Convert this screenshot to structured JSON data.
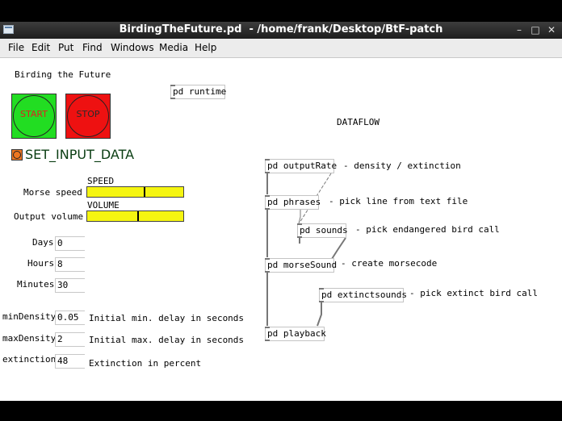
{
  "window": {
    "title": "BirdingTheFuture.pd  - /home/frank/Desktop/BtF-patch",
    "minimize_glyph": "–",
    "maximize_glyph": "□",
    "close_glyph": "✕"
  },
  "menu": [
    "File",
    "Edit",
    "Put",
    "Find",
    "Windows",
    "Media",
    "Help"
  ],
  "patch": {
    "heading": "Birding the Future",
    "start_label": "START",
    "stop_label": "STOP",
    "set_input_label": "SET_INPUT_DATA",
    "runtime_object": "pd runtime",
    "dataflow_label": "DATAFLOW",
    "speed_header": "SPEED",
    "volume_header": "VOLUME",
    "morse_speed_label": "Morse speed",
    "output_volume_label": "Output volume",
    "speed_level": 0.6,
    "volume_level": 0.53,
    "params": [
      {
        "label": "Days",
        "value": "0"
      },
      {
        "label": "Hours",
        "value": "8"
      },
      {
        "label": "Minutes",
        "value": "30"
      },
      {
        "label": "minDensity",
        "value": "0.05",
        "desc": "Initial min. delay in seconds"
      },
      {
        "label": "maxDensity",
        "value": "2",
        "desc": "Initial max. delay in seconds"
      },
      {
        "label": "extinction",
        "value": "48",
        "desc": "Extinction in percent"
      }
    ],
    "objects": [
      {
        "name": "pd outputRate",
        "comment": "- density / extinction"
      },
      {
        "name": "pd phrases",
        "comment": "- pick line from text file"
      },
      {
        "name": "pd sounds",
        "comment": "- pick endangered bird call"
      },
      {
        "name": "pd morseSound",
        "comment": "- create morsecode"
      },
      {
        "name": "pd extinctsounds",
        "comment": "- pick extinct bird call"
      },
      {
        "name": "pd playback",
        "comment": ""
      }
    ]
  },
  "colors": {
    "start_bg": "#22dd22",
    "start_text": "#dd2222",
    "stop_bg": "#ee1111",
    "stop_text": "#2a2a2a",
    "slider": "#f5f511",
    "set_input_text": "#0a3d12",
    "set_input_bang": "#ee7722"
  }
}
